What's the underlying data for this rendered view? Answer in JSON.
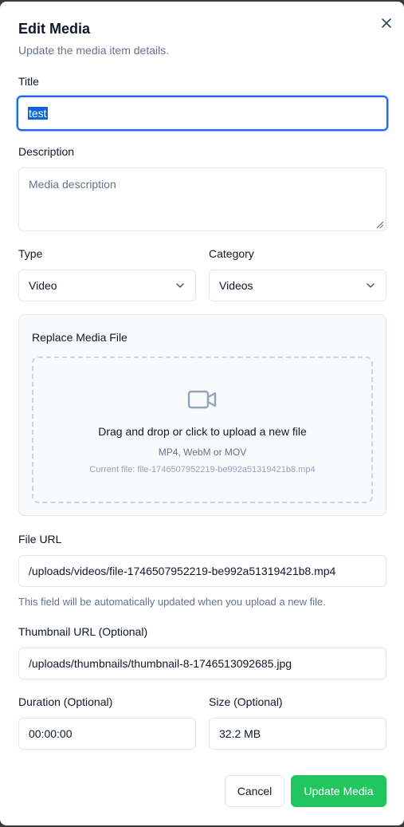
{
  "dialog": {
    "title": "Edit Media",
    "subtitle": "Update the media item details.",
    "close_icon": "close-icon"
  },
  "form": {
    "title_label": "Title",
    "title_value": "test",
    "description_label": "Description",
    "description_placeholder": "Media description",
    "type_label": "Type",
    "type_value": "Video",
    "category_label": "Category",
    "category_value": "Videos",
    "replace": {
      "heading": "Replace Media File",
      "icon": "video-camera-icon",
      "main_text": "Drag and drop or click to upload a new file",
      "formats": "MP4, WebM or MOV",
      "current_file": "Current file: file-1746507952219-be992a51319421b8.mp4"
    },
    "file_url_label": "File URL",
    "file_url_value": "/uploads/videos/file-1746507952219-be992a51319421b8.mp4",
    "file_url_hint": "This field will be automatically updated when you upload a new file.",
    "thumbnail_label": "Thumbnail URL (Optional)",
    "thumbnail_value": "/uploads/thumbnails/thumbnail-8-1746513092685.jpg",
    "duration_label": "Duration (Optional)",
    "duration_value": "00:00:00",
    "size_label": "Size (Optional)",
    "size_value": "32.2 MB"
  },
  "actions": {
    "cancel_label": "Cancel",
    "submit_label": "Update Media"
  },
  "colors": {
    "primary": "#22c55e",
    "focus_ring": "#2563eb",
    "muted_text": "#64748b"
  }
}
